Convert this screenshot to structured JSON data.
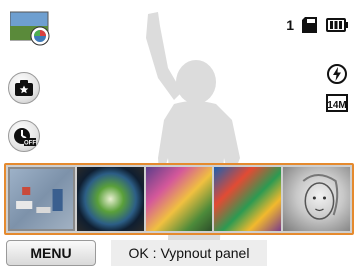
{
  "status": {
    "shot_count": "1",
    "icons": [
      "memory-card-icon",
      "battery-icon",
      "flash-auto-icon",
      "image-size-14m-icon"
    ]
  },
  "left_controls": {
    "icons": [
      "scene-mode-thumbnail-icon",
      "smart-filter-icon",
      "timer-off-icon"
    ]
  },
  "filter_strip": {
    "items": [
      {
        "name": "miniature",
        "selected": true
      },
      {
        "name": "fish-eye",
        "selected": false
      },
      {
        "name": "oil-painting",
        "selected": false
      },
      {
        "name": "cartoon",
        "selected": false
      },
      {
        "name": "sketch",
        "selected": false
      }
    ],
    "border_color": "#e58a2e"
  },
  "bottom": {
    "menu_label": "MENU",
    "hint_text": "OK : Vypnout panel"
  }
}
